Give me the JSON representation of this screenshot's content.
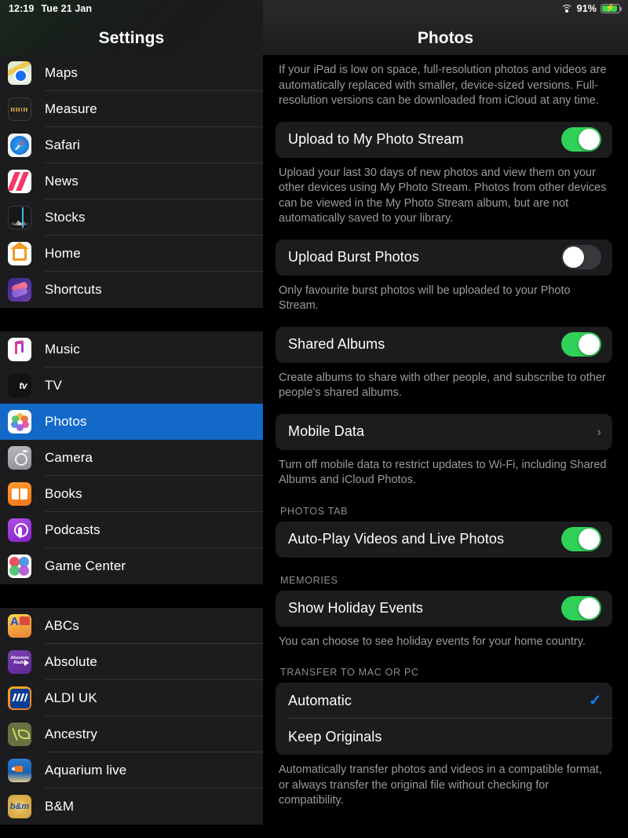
{
  "status_bar": {
    "time": "12:19",
    "date": "Tue 21 Jan",
    "wifi_icon": "wifi-icon",
    "battery_percent": "91%",
    "battery_charging_icon": "lightning-bolt-icon"
  },
  "sidebar": {
    "title": "Settings",
    "groups": [
      {
        "items": [
          {
            "label": "Maps",
            "icon": "maps-icon"
          },
          {
            "label": "Measure",
            "icon": "measure-icon"
          },
          {
            "label": "Safari",
            "icon": "safari-icon"
          },
          {
            "label": "News",
            "icon": "news-icon"
          },
          {
            "label": "Stocks",
            "icon": "stocks-icon"
          },
          {
            "label": "Home",
            "icon": "home-icon"
          },
          {
            "label": "Shortcuts",
            "icon": "shortcuts-icon"
          }
        ]
      },
      {
        "items": [
          {
            "label": "Music",
            "icon": "music-icon"
          },
          {
            "label": "TV",
            "icon": "apple-tv-icon"
          },
          {
            "label": "Photos",
            "icon": "photos-icon",
            "selected": true
          },
          {
            "label": "Camera",
            "icon": "camera-icon"
          },
          {
            "label": "Books",
            "icon": "books-icon"
          },
          {
            "label": "Podcasts",
            "icon": "podcasts-icon"
          },
          {
            "label": "Game Center",
            "icon": "game-center-icon"
          }
        ]
      },
      {
        "items": [
          {
            "label": "ABCs",
            "icon": "abcs-icon"
          },
          {
            "label": "Absolute",
            "icon": "absolute-radio-icon"
          },
          {
            "label": "ALDI UK",
            "icon": "aldi-uk-icon"
          },
          {
            "label": "Ancestry",
            "icon": "ancestry-icon"
          },
          {
            "label": "Aquarium live",
            "icon": "aquarium-live-icon"
          },
          {
            "label": "B&M",
            "icon": "bm-icon"
          }
        ]
      }
    ]
  },
  "detail": {
    "title": "Photos",
    "intro_footnote": "If your iPad is low on space, full-resolution photos and videos are automatically replaced with smaller, device-sized versions. Full-resolution versions can be downloaded from iCloud at any time.",
    "photo_stream": {
      "label": "Upload to My Photo Stream",
      "toggle_state": "on",
      "footnote": "Upload your last 30 days of new photos and view them on your other devices using My Photo Stream. Photos from other devices can be viewed in the My Photo Stream album, but are not automatically saved to your library."
    },
    "burst": {
      "label": "Upload Burst Photos",
      "toggle_state": "off",
      "footnote": "Only favourite burst photos will be uploaded to your Photo Stream."
    },
    "shared_albums": {
      "label": "Shared Albums",
      "toggle_state": "on",
      "footnote": "Create albums to share with other people, and subscribe to other people's shared albums."
    },
    "mobile_data": {
      "label": "Mobile Data",
      "disclosure_icon": "chevron-right-icon",
      "footnote": "Turn off mobile data to restrict updates to Wi-Fi, including Shared Albums and iCloud Photos."
    },
    "photos_tab": {
      "section_header": "PHOTOS TAB",
      "autoplay_label": "Auto-Play Videos and Live Photos",
      "autoplay_toggle_state": "on"
    },
    "memories": {
      "section_header": "MEMORIES",
      "holiday_label": "Show Holiday Events",
      "holiday_toggle_state": "on",
      "footnote": "You can choose to see holiday events for your home country."
    },
    "transfer": {
      "section_header": "TRANSFER TO MAC OR PC",
      "option_automatic": "Automatic",
      "option_keep_originals": "Keep Originals",
      "selected_option": "Automatic",
      "check_icon": "checkmark-icon",
      "footnote": "Automatically transfer photos and videos in a compatible format, or always transfer the original file without checking for compatibility."
    }
  },
  "colors": {
    "selection_blue": "#1269c8",
    "toggle_on_green": "#30d158",
    "toggle_off_gray": "#39393d",
    "accent_blue": "#0a84ff",
    "card_bg": "#1c1c1e",
    "footnote_gray": "#9b9b9f"
  }
}
